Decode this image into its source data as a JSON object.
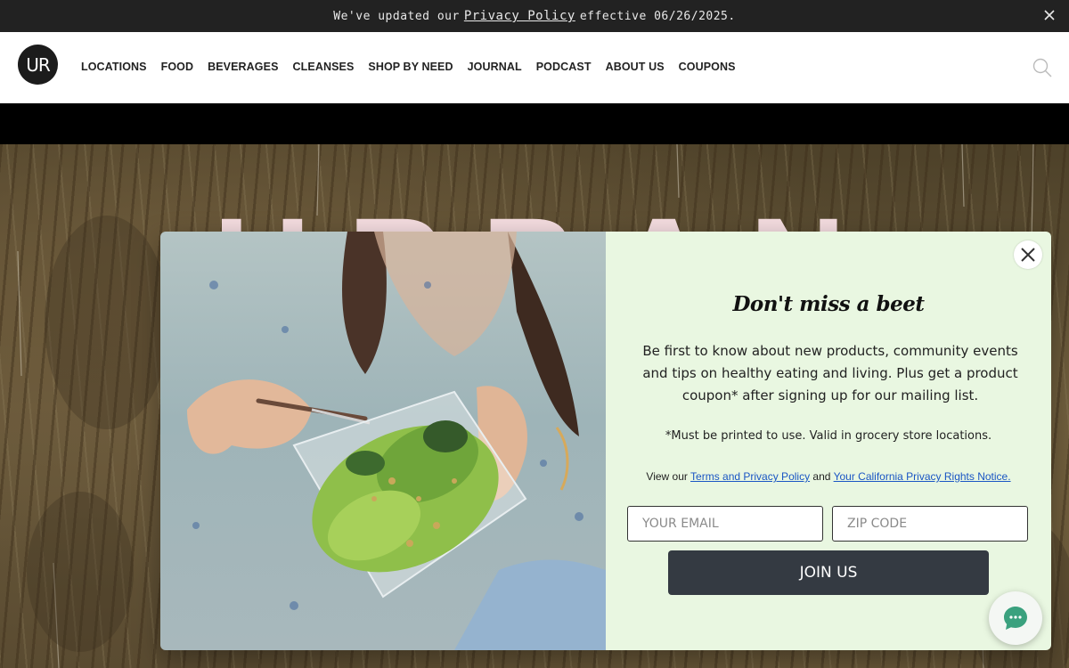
{
  "announcement": {
    "prefix": "We've updated our",
    "link_label": "Privacy Policy",
    "suffix": "effective 06/26/2025."
  },
  "header": {
    "logo_text": "UR",
    "nav": [
      "LOCATIONS",
      "FOOD",
      "BEVERAGES",
      "CLEANSES",
      "SHOP BY NEED",
      "JOURNAL",
      "PODCAST",
      "ABOUT US",
      "COUPONS"
    ]
  },
  "hero": {
    "title": "URBAN"
  },
  "modal": {
    "heading": "Don't miss a beet",
    "body": "Be first to know about new products, community events and tips on healthy eating and living. Plus get a product coupon* after signing up for our mailing list.",
    "fine_print": "*Must be printed to use. Valid in grocery store locations.",
    "terms_prefix": "View our",
    "terms_link": "Terms and Privacy Policy",
    "terms_and": "and",
    "privacy_link": "Your California Privacy Rights Notice.",
    "email_placeholder": "YOUR EMAIL",
    "zip_placeholder": "ZIP CODE",
    "submit_label": "JOIN US"
  },
  "colors": {
    "announce_bg": "#222222",
    "form_bg": "#e9f7e1",
    "button_bg": "#343a42",
    "link": "#1a56c4",
    "chat_icon": "#3aa17e"
  }
}
